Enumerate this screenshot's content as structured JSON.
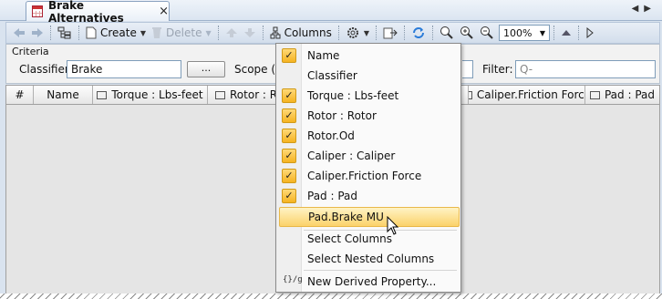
{
  "tab": {
    "title": "Brake Alternatives",
    "close": "×",
    "nav_prev": "◀",
    "nav_next": "▶"
  },
  "toolbar": {
    "create_label": "Create",
    "delete_label": "Delete",
    "columns_label": "Columns",
    "zoom_value": "100%",
    "icons": [
      "back-icon",
      "forward-icon",
      "hierarchy-icon",
      "new-icon",
      "delete-icon",
      "move-up-icon",
      "move-down-icon",
      "columns-icon",
      "settings-icon",
      "export-icon",
      "refresh-icon",
      "zoom-icon",
      "zoom-in-icon",
      "zoom-out-icon",
      "collapse-icon",
      "expand-icon"
    ]
  },
  "criteria": {
    "title": "Criteria",
    "classifier_label": "Classifier:",
    "classifier_value": "Brake",
    "browse_button": "...",
    "scope_label": "Scope (op",
    "filter_label": "Filter:",
    "filter_placeholder": "Q-"
  },
  "table": {
    "columns": [
      "#",
      "Name",
      "Torque : Lbs-feet",
      "Rotor : Ro",
      "",
      "Caliper.Friction Force",
      "Pad : Pad"
    ]
  },
  "menu": {
    "items": [
      {
        "label": "Name",
        "checked": true
      },
      {
        "label": "Classifier",
        "checked": false
      },
      {
        "label": "Torque : Lbs-feet",
        "checked": true
      },
      {
        "label": "Rotor : Rotor",
        "checked": true
      },
      {
        "label": "Rotor.Od",
        "checked": true
      },
      {
        "label": "Caliper : Caliper",
        "checked": true
      },
      {
        "label": "Caliper.Friction Force",
        "checked": true
      },
      {
        "label": "Pad : Pad",
        "checked": true
      },
      {
        "label": "Pad.Brake MU",
        "checked": false,
        "highlighted": true
      }
    ],
    "select_columns": "Select Columns",
    "select_nested": "Select Nested Columns",
    "new_derived": "New Derived Property...",
    "derived_icon_text": "{}/g",
    "check_glyph": "✓"
  },
  "colors": {
    "highlight": "#fbd26a",
    "check_bg": "#f5b321",
    "toolbar_bg": "#d3deec"
  }
}
